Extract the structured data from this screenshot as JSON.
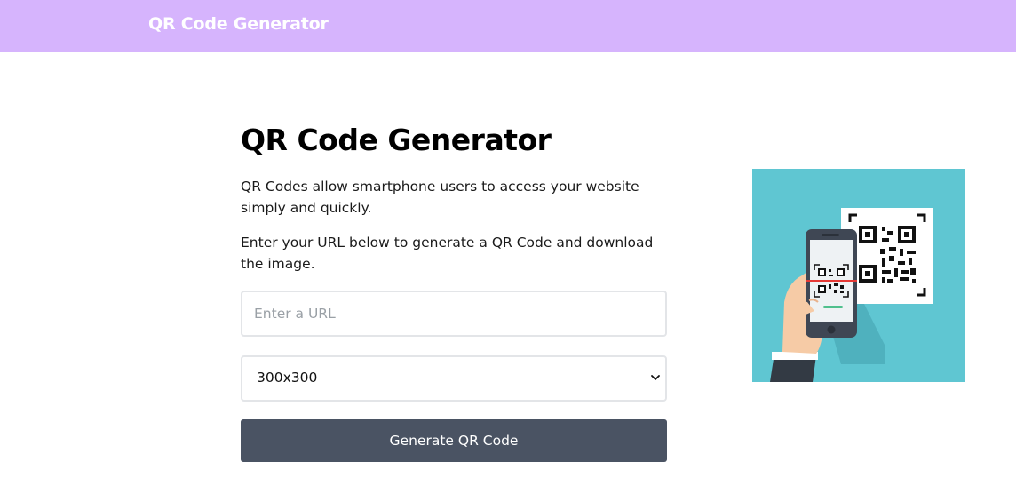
{
  "header": {
    "brand": "QR Code Generator",
    "background": "#d6b4fd"
  },
  "main": {
    "title": "QR Code Generator",
    "intro": "QR Codes allow smartphone users to access your website simply and quickly.",
    "instructions": "Enter your URL below to generate a QR Code and download the image.",
    "url_input": {
      "value": "",
      "placeholder": "Enter a URL"
    },
    "size_select": {
      "selected": "300x300"
    },
    "generate_button": {
      "label": "Generate QR Code",
      "color": "#4a5363"
    }
  },
  "illustration": {
    "icon": "phone-scanning-qr-illustration",
    "background": "#5fc6d2"
  }
}
